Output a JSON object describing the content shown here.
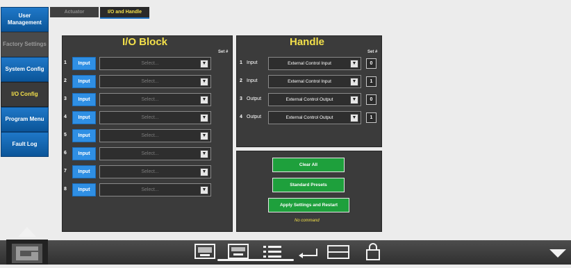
{
  "sidebar": {
    "items": [
      {
        "label": "User Management",
        "state": "normal"
      },
      {
        "label": "Factory Settings",
        "state": "disabled"
      },
      {
        "label": "System Config",
        "state": "normal"
      },
      {
        "label": "I/O Config",
        "state": "active"
      },
      {
        "label": "Program Menu",
        "state": "normal"
      },
      {
        "label": "Fault Log",
        "state": "normal"
      }
    ]
  },
  "tabs": [
    {
      "label": "Actuator",
      "selected": false
    },
    {
      "label": "I/O and Handle",
      "selected": true
    }
  ],
  "io_block": {
    "title": "I/O Block",
    "set_header": "Set #",
    "rows": [
      {
        "num": "1",
        "type": "Input",
        "select": "Select..."
      },
      {
        "num": "2",
        "type": "Input",
        "select": "Select..."
      },
      {
        "num": "3",
        "type": "Input",
        "select": "Select..."
      },
      {
        "num": "4",
        "type": "Input",
        "select": "Select..."
      },
      {
        "num": "5",
        "type": "Input",
        "select": "Select..."
      },
      {
        "num": "6",
        "type": "Input",
        "select": "Select..."
      },
      {
        "num": "7",
        "type": "Input",
        "select": "Select..."
      },
      {
        "num": "8",
        "type": "Input",
        "select": "Select..."
      }
    ]
  },
  "handle": {
    "title": "Handle",
    "set_header": "Set #",
    "rows": [
      {
        "num": "1",
        "type": "Input",
        "select": "External Control Input",
        "set": "0"
      },
      {
        "num": "2",
        "type": "Input",
        "select": "External Control Input",
        "set": "1"
      },
      {
        "num": "3",
        "type": "Output",
        "select": "External Control Output",
        "set": "0"
      },
      {
        "num": "4",
        "type": "Output",
        "select": "External Control Output",
        "set": "1"
      }
    ]
  },
  "actions": {
    "clear_all": "Clear All",
    "standard_presets": "Standard Presets",
    "apply_restart": "Apply Settings and Restart",
    "status": "No command"
  },
  "bottom_bar": {
    "icons": [
      "up-arrow-icon",
      "keyboard-icon",
      "keyboard-wide-icon",
      "list-icon",
      "return-icon",
      "windows-icon",
      "lock-icon",
      "down-arrow-icon"
    ]
  },
  "colors": {
    "accent_yellow": "#f3e04a",
    "button_blue": "#2f8fe4",
    "button_green": "#1ea03c",
    "panel": "#3b3b3b"
  }
}
